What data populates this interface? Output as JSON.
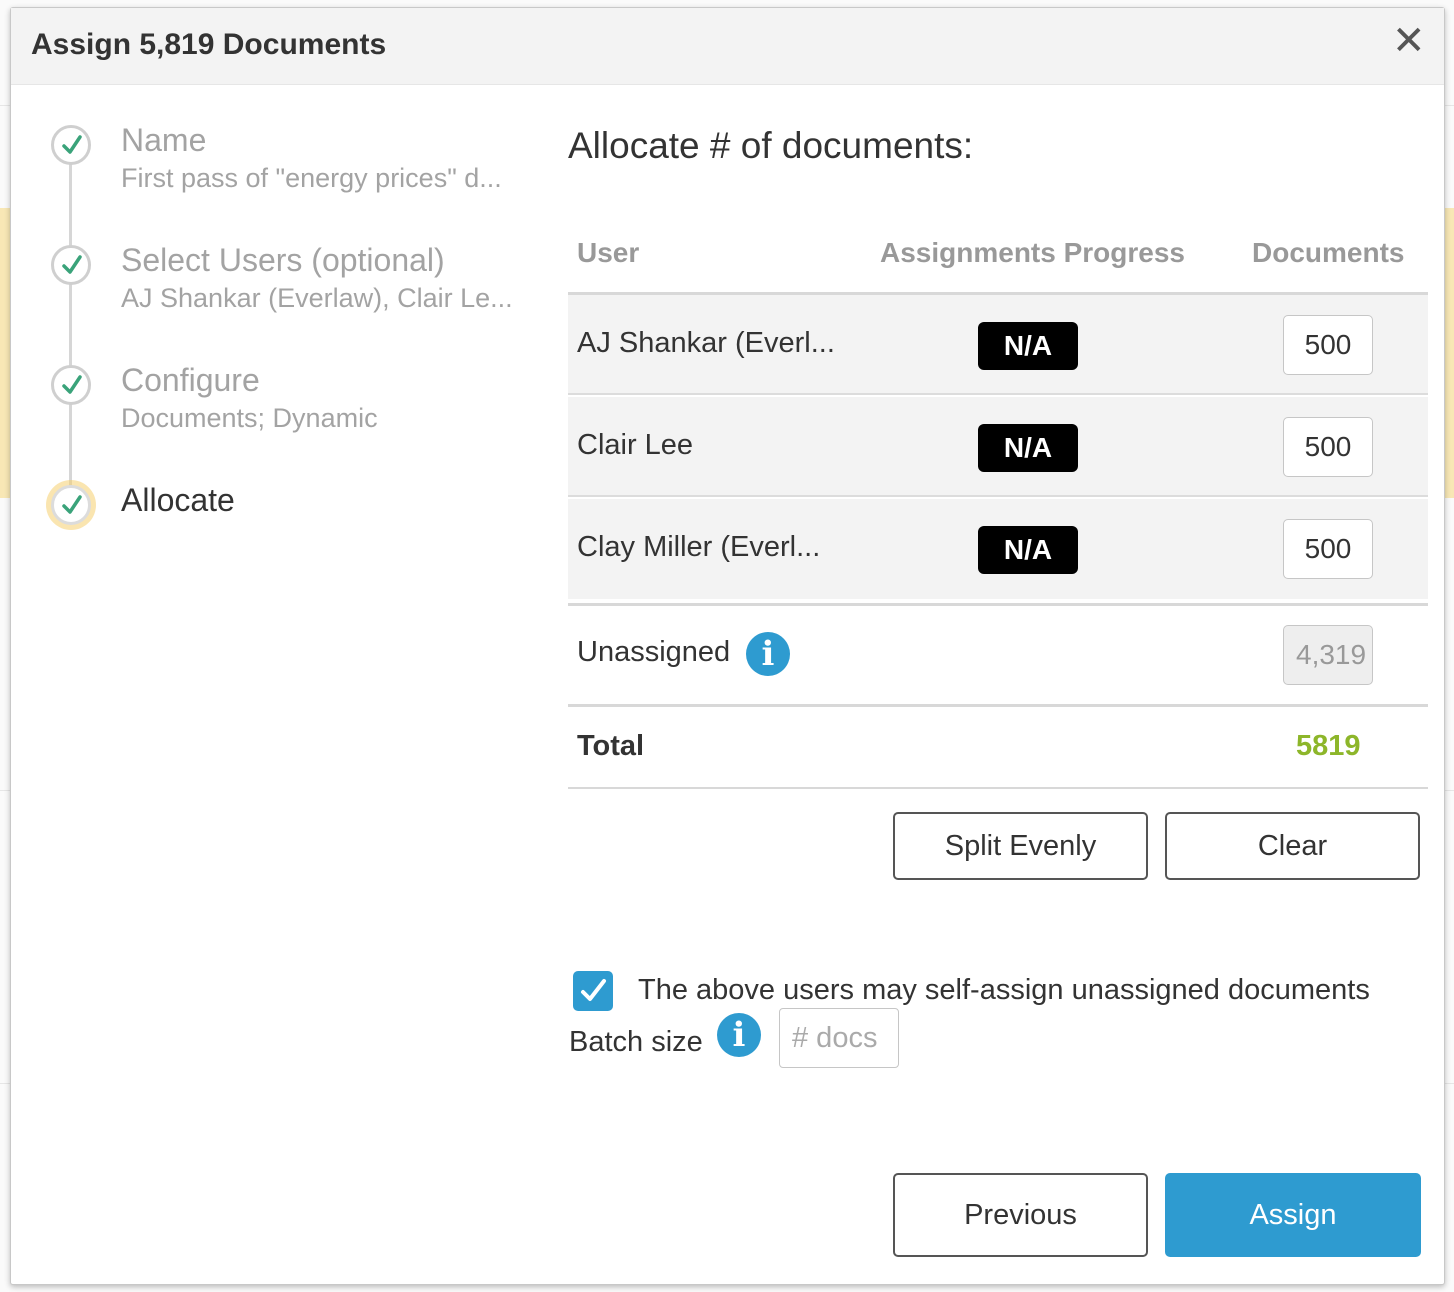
{
  "modal": {
    "title": "Assign 5,819 Documents",
    "close_icon": "close-icon"
  },
  "steps": [
    {
      "title": "Name",
      "subtitle": "First pass of \"energy prices\" d...",
      "status": "complete"
    },
    {
      "title": "Select Users (optional)",
      "subtitle": "AJ Shankar (Everlaw), Clair Le...",
      "status": "complete"
    },
    {
      "title": "Configure",
      "subtitle": "Documents; Dynamic",
      "status": "complete"
    },
    {
      "title": "Allocate",
      "subtitle": "",
      "status": "active"
    }
  ],
  "allocate": {
    "title": "Allocate # of documents:",
    "columns": {
      "user": "User",
      "progress": "Assignments Progress",
      "documents": "Documents"
    },
    "rows": [
      {
        "user": "AJ Shankar (Everl...",
        "progress": "N/A",
        "documents": "500"
      },
      {
        "user": "Clair Lee",
        "progress": "N/A",
        "documents": "500"
      },
      {
        "user": "Clay Miller (Everl...",
        "progress": "N/A",
        "documents": "500"
      }
    ],
    "unassigned": {
      "label": "Unassigned",
      "value": "4,319"
    },
    "total": {
      "label": "Total",
      "value": "5819"
    },
    "split_evenly_label": "Split Evenly",
    "clear_label": "Clear",
    "self_assign": {
      "checked": true,
      "label": "The above users may self-assign unassigned documents"
    },
    "batch": {
      "label": "Batch size",
      "placeholder": "# docs"
    }
  },
  "footer": {
    "previous_label": "Previous",
    "assign_label": "Assign"
  },
  "colors": {
    "accent": "#2e9bd0",
    "total": "#8db62a",
    "check": "#3aa37a"
  }
}
